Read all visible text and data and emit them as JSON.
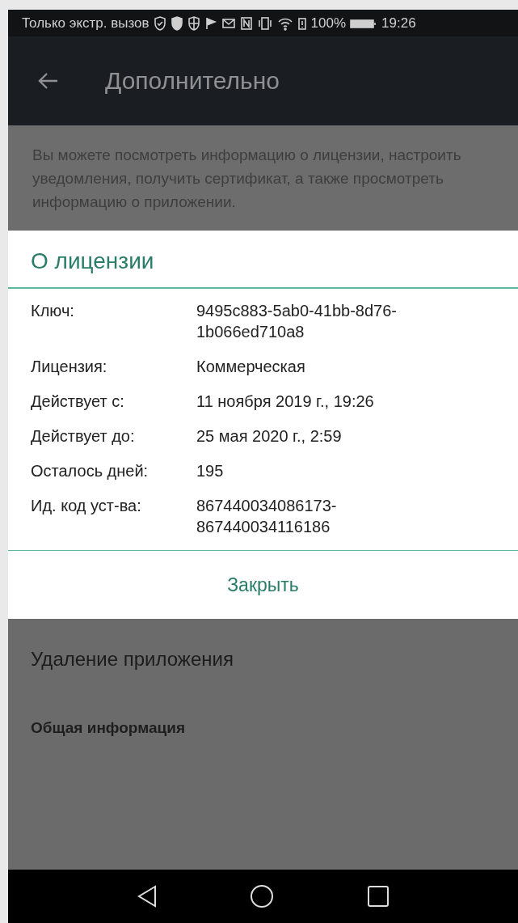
{
  "status_bar": {
    "carrier_text": "Только экстр. вызов",
    "battery_text": "100%",
    "time": "19:26"
  },
  "app_bar": {
    "title": "Дополнительно"
  },
  "description": "Вы можете посмотреть информацию о лицензии, настроить уведомления, получить сертификат, а также просмотреть информацию о приложении.",
  "dialog": {
    "title": "О лицензии",
    "rows": [
      {
        "label": "Ключ:",
        "value": "9495c883-5ab0-41bb-8d76-1b066ed710a8"
      },
      {
        "label": "Лицензия:",
        "value": "Коммерческая"
      },
      {
        "label": "Действует с:",
        "value": "11 ноября 2019 г., 19:26"
      },
      {
        "label": "Действует до:",
        "value": "25 мая 2020 г., 2:59"
      },
      {
        "label": "Осталось дней:",
        "value": "195"
      },
      {
        "label": "Ид. код уст-ва:",
        "value": "867440034086173-867440034116186"
      }
    ],
    "button": "Закрыть"
  },
  "settings": [
    {
      "label": "Удаление приложения",
      "kind": "item"
    },
    {
      "label": "Общая информация",
      "kind": "header"
    }
  ]
}
